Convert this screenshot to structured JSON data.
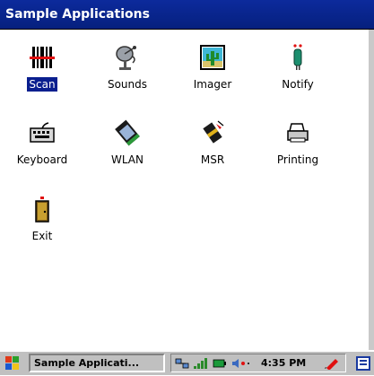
{
  "window": {
    "title": "Sample Applications"
  },
  "apps": [
    {
      "label": "Scan",
      "icon": "barcode-scanner-icon",
      "selected": true
    },
    {
      "label": "Sounds",
      "icon": "satellite-dish-icon"
    },
    {
      "label": "Imager",
      "icon": "cactus-picture-icon"
    },
    {
      "label": "Notify",
      "icon": "notification-led-icon"
    },
    {
      "label": "Keyboard",
      "icon": "keyboard-icon"
    },
    {
      "label": "WLAN",
      "icon": "wlan-card-icon"
    },
    {
      "label": "MSR",
      "icon": "magnetic-stripe-reader-icon"
    },
    {
      "label": "Printing",
      "icon": "printer-icon"
    },
    {
      "label": "Exit",
      "icon": "exit-door-icon"
    }
  ],
  "taskbar": {
    "task_label": "Sample Applicati...",
    "clock": "4:35 PM"
  },
  "colors": {
    "titlebar": "#0a2590",
    "selection": "#0a1f8f"
  }
}
